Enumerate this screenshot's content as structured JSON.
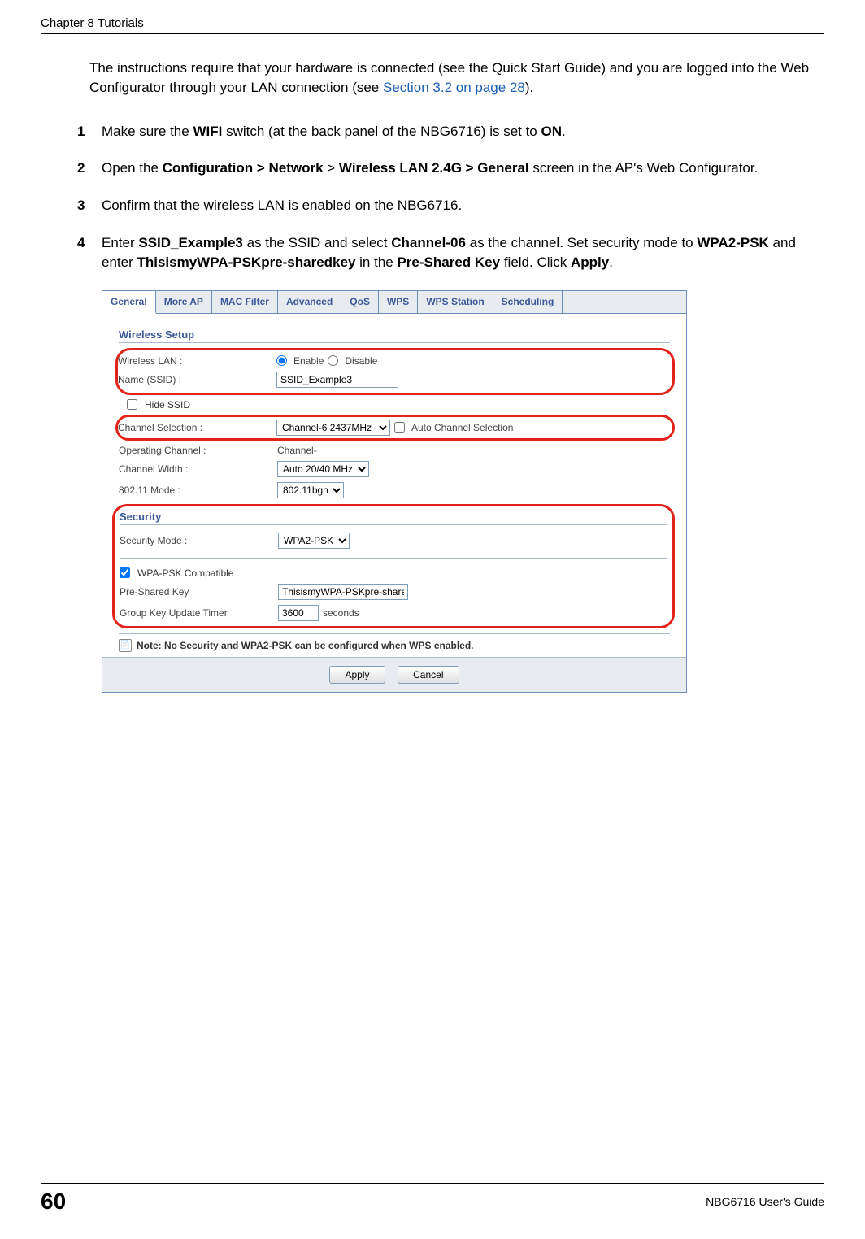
{
  "header": {
    "chapter": "Chapter 8 Tutorials"
  },
  "intro": {
    "text_before_link": "The instructions require that your hardware is connected (see the Quick Start Guide) and you are logged into the Web Configurator through your LAN connection (see ",
    "link_text": "Section 3.2 on page 28",
    "text_after_link": ")."
  },
  "steps": {
    "s1": {
      "num": "1",
      "t1": "Make sure the ",
      "b1": "WIFI",
      "t2": " switch (at the back panel of the NBG6716) is set to ",
      "b2": "ON",
      "t3": "."
    },
    "s2": {
      "num": "2",
      "t1": "Open the ",
      "b1": "Configuration > Network",
      "t2": " > ",
      "b2": "Wireless LAN 2.4G > General",
      "t3": " screen in the AP's Web Configurator."
    },
    "s3": {
      "num": "3",
      "t1": "Confirm that the wireless LAN is enabled on the NBG6716."
    },
    "s4": {
      "num": "4",
      "t1": "Enter ",
      "b1": "SSID_Example3",
      "t2": " as the SSID and select ",
      "b2": "Channel-06",
      "t3": " as the channel. Set security mode to ",
      "b3": "WPA2-PSK",
      "t4": " and enter ",
      "b4": "ThisismyWPA-PSKpre-sharedkey",
      "t5": " in the ",
      "b5": "Pre-Shared Key",
      "t6": " field. Click ",
      "b6": "Apply",
      "t7": "."
    }
  },
  "screenshot": {
    "tabs": {
      "general": "General",
      "more_ap": "More AP",
      "mac_filter": "MAC Filter",
      "advanced": "Advanced",
      "qos": "QoS",
      "wps": "WPS",
      "wps_station": "WPS Station",
      "scheduling": "Scheduling"
    },
    "wireless_setup": {
      "heading": "Wireless Setup",
      "wlan_label": "Wireless LAN :",
      "enable": "Enable",
      "disable": "Disable",
      "name_label": "Name (SSID) :",
      "ssid_value": "SSID_Example3",
      "hide_ssid": "Hide SSID",
      "channel_sel_label": "Channel Selection :",
      "channel_value": "Channel-6 2437MHz",
      "auto_channel": "Auto Channel Selection",
      "op_channel_label": "Operating Channel :",
      "op_channel_value": "Channel-",
      "channel_width_label": "Channel Width :",
      "channel_width_value": "Auto 20/40 MHz",
      "mode_label": "802.11 Mode :",
      "mode_value": "802.11bgn"
    },
    "security": {
      "heading": "Security",
      "mode_label": "Security Mode :",
      "mode_value": "WPA2-PSK",
      "wpa_compat": "WPA-PSK Compatible",
      "psk_label": "Pre-Shared Key",
      "psk_value": "ThisismyWPA-PSKpre-sharedk",
      "timer_label": "Group Key Update Timer",
      "timer_value": "3600",
      "timer_unit": "seconds"
    },
    "note": "Note: No Security and WPA2-PSK can be configured when WPS enabled.",
    "buttons": {
      "apply": "Apply",
      "cancel": "Cancel"
    }
  },
  "footer": {
    "page": "60",
    "guide": "NBG6716 User's Guide"
  }
}
